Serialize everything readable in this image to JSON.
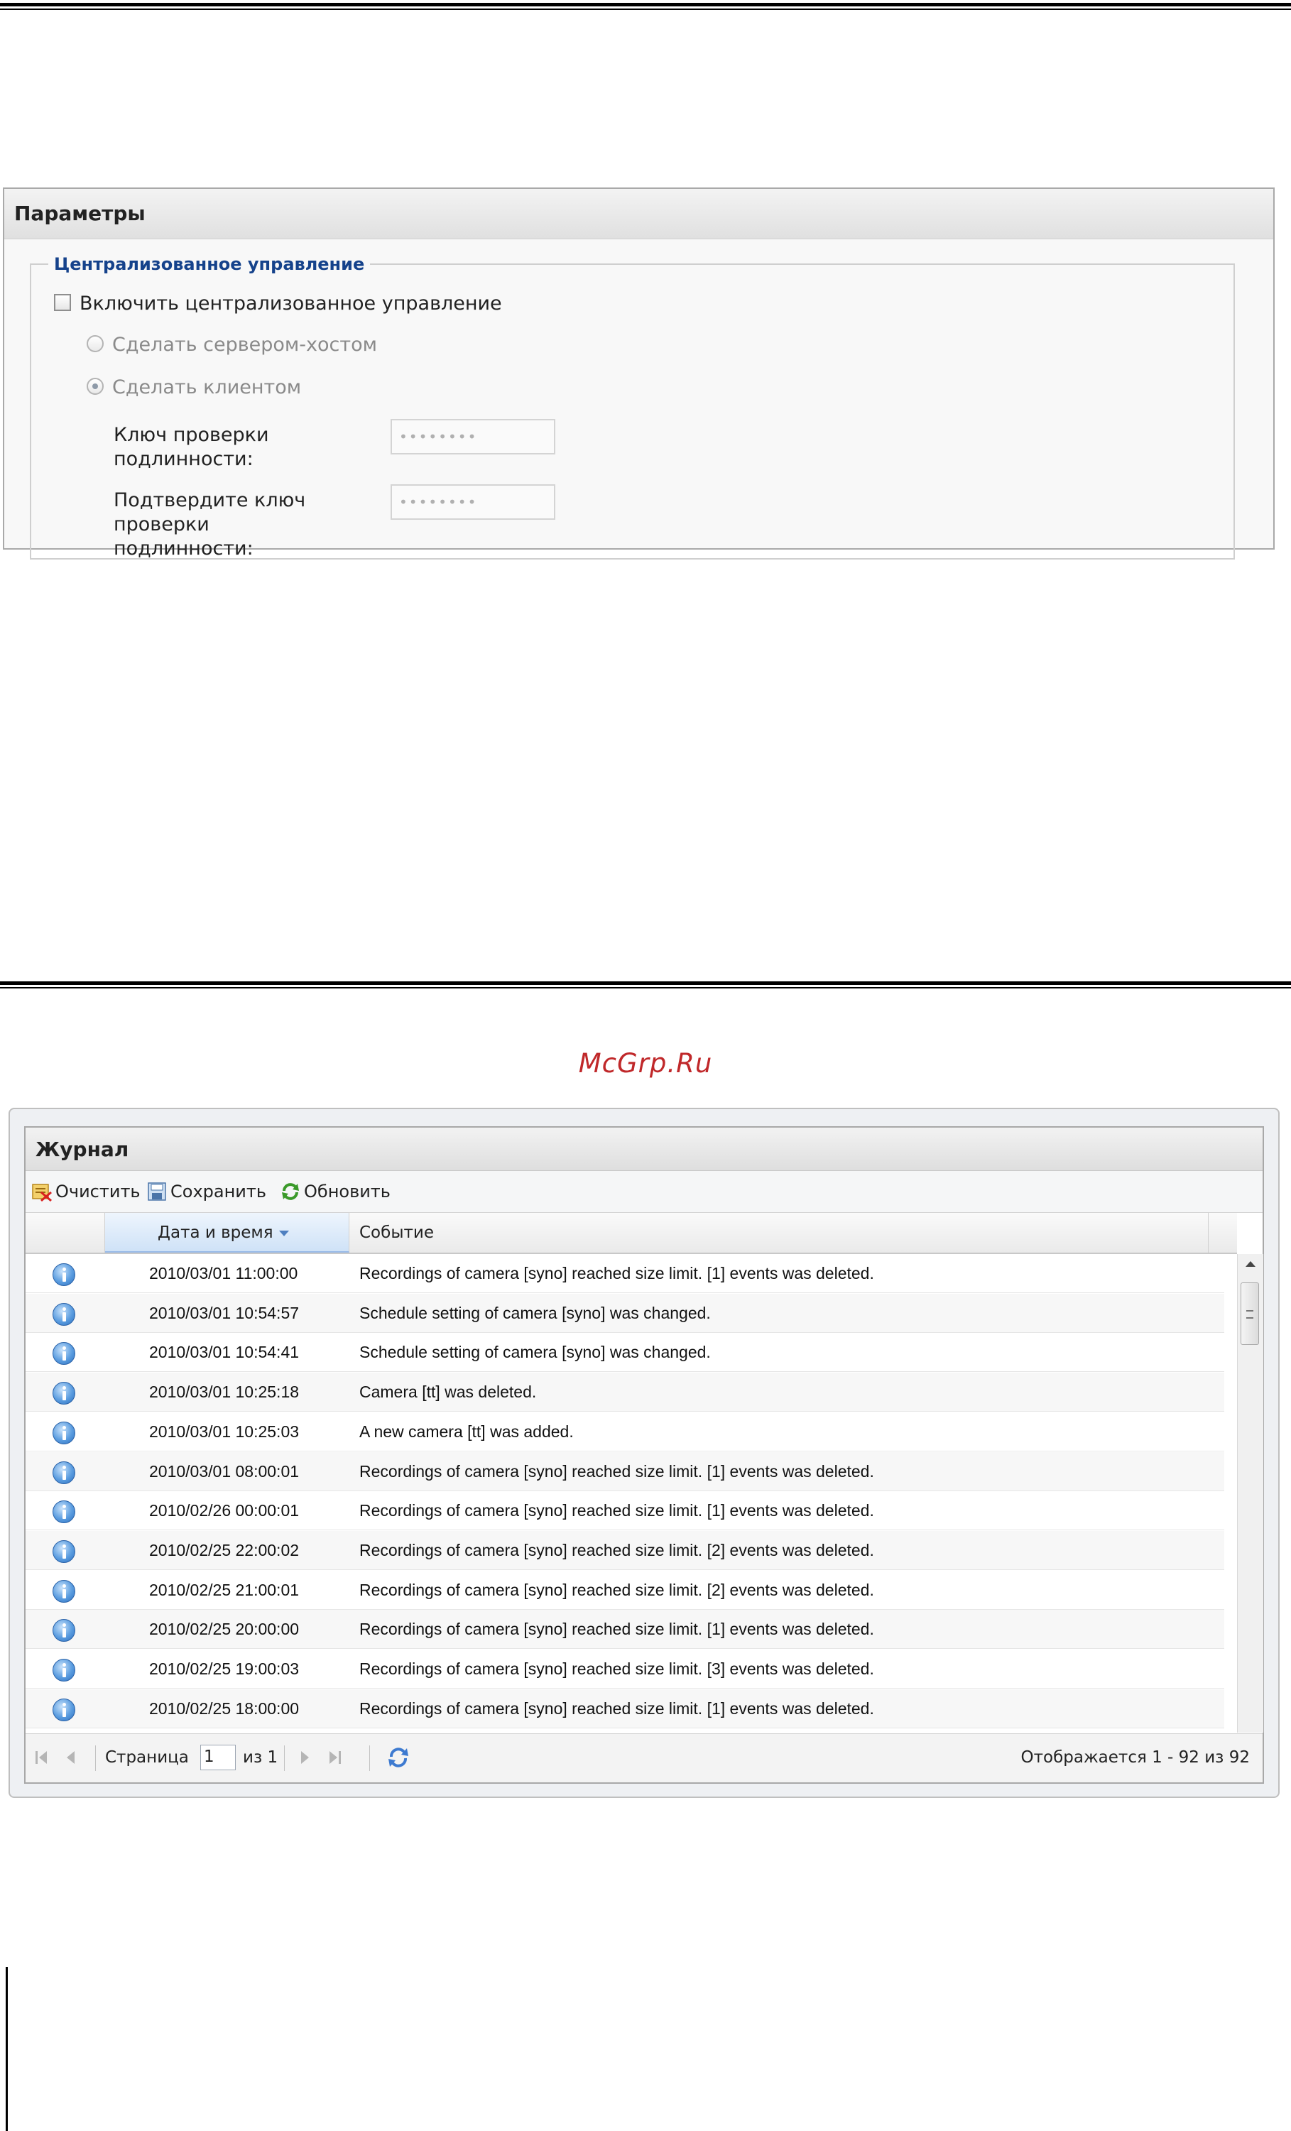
{
  "params_panel": {
    "title": "Параметры",
    "group_title": "Централизованное управление",
    "enable_checkbox": {
      "label": "Включить централизованное управление",
      "checked": false
    },
    "radio_host": {
      "label": "Сделать сервером-хостом",
      "selected": false
    },
    "radio_client": {
      "label": "Сделать клиентом",
      "selected": true
    },
    "auth_key": {
      "label": "Ключ проверки подлинности:",
      "value": "••••••••"
    },
    "confirm_key": {
      "label": "Подтвердите ключ проверки подлинности:",
      "value": "••••••••"
    }
  },
  "watermark": "McGrp.Ru",
  "journal_panel": {
    "title": "Журнал",
    "toolbar": {
      "clear_label": "Очистить",
      "save_label": "Сохранить",
      "refresh_label": "Обновить"
    },
    "columns": {
      "datetime": "Дата и время",
      "event": "Событие"
    },
    "rows": [
      {
        "datetime": "2010/03/01 11:00:00",
        "event": "Recordings of camera [syno] reached size limit. [1] events was deleted."
      },
      {
        "datetime": "2010/03/01 10:54:57",
        "event": "Schedule setting of camera [syno] was changed."
      },
      {
        "datetime": "2010/03/01 10:54:41",
        "event": "Schedule setting of camera [syno] was changed."
      },
      {
        "datetime": "2010/03/01 10:25:18",
        "event": "Camera [tt] was deleted."
      },
      {
        "datetime": "2010/03/01 10:25:03",
        "event": "A new camera [tt] was added."
      },
      {
        "datetime": "2010/03/01 08:00:01",
        "event": "Recordings of camera [syno] reached size limit. [1] events was deleted."
      },
      {
        "datetime": "2010/02/26 00:00:01",
        "event": "Recordings of camera [syno] reached size limit. [1] events was deleted."
      },
      {
        "datetime": "2010/02/25 22:00:02",
        "event": "Recordings of camera [syno] reached size limit. [2] events was deleted."
      },
      {
        "datetime": "2010/02/25 21:00:01",
        "event": "Recordings of camera [syno] reached size limit. [2] events was deleted."
      },
      {
        "datetime": "2010/02/25 20:00:00",
        "event": "Recordings of camera [syno] reached size limit. [1] events was deleted."
      },
      {
        "datetime": "2010/02/25 19:00:03",
        "event": "Recordings of camera [syno] reached size limit. [3] events was deleted."
      },
      {
        "datetime": "2010/02/25 18:00:00",
        "event": "Recordings of camera [syno] reached size limit. [1] events was deleted."
      }
    ],
    "pager": {
      "page_label": "Страница",
      "page_value": "1",
      "of_label": "из 1",
      "display_info": "Отображается 1 - 92 из 92"
    }
  }
}
